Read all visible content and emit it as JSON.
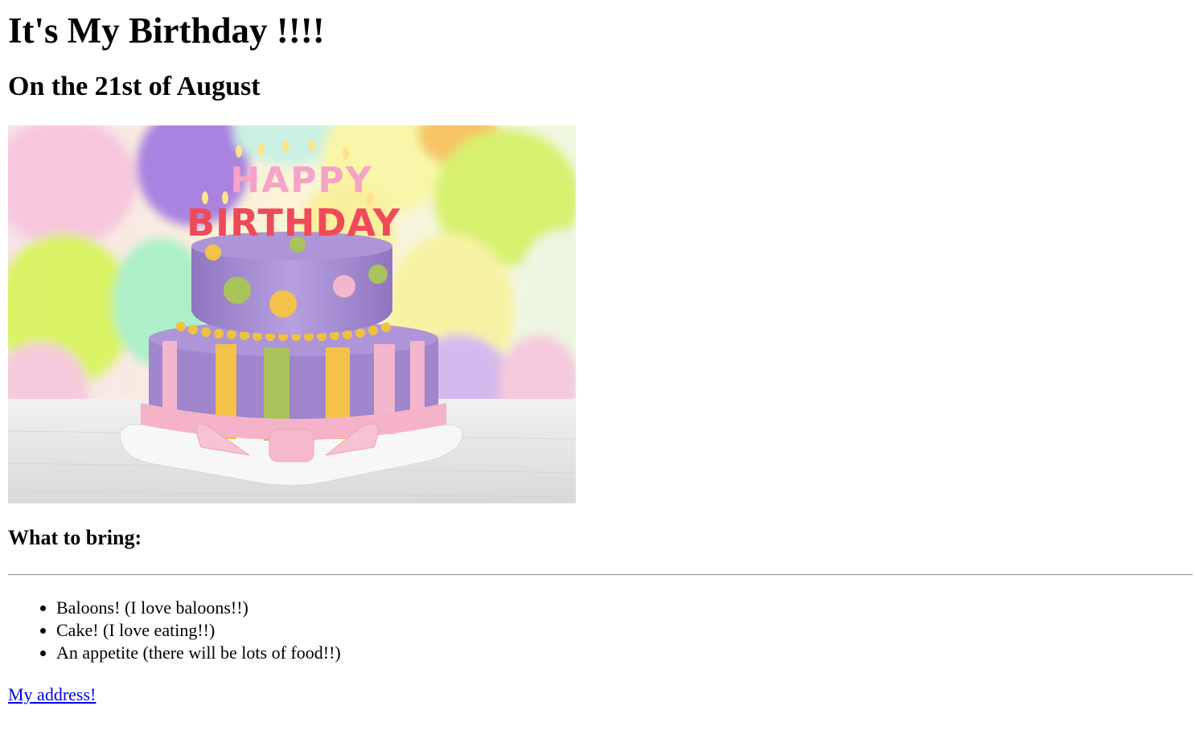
{
  "page": {
    "heading": "It's My Birthday !!!!",
    "subheading": "On the 21st of August",
    "image": {
      "cake_text_top": "HAPPY",
      "cake_text_bottom": "BIRTHDAY"
    },
    "bring_heading": "What to bring:",
    "bring_items": [
      "Baloons! (I love baloons!!)",
      "Cake! (I love eating!!)",
      "An appetite (there will be lots of food!!)"
    ],
    "address_link": "My address!"
  },
  "colors": {
    "link": "#0000ee",
    "cake_purple": "#a48ad0",
    "cake_pink": "#f4b6cc",
    "cake_yellow": "#f2c24a",
    "cake_green": "#a9c25a"
  }
}
